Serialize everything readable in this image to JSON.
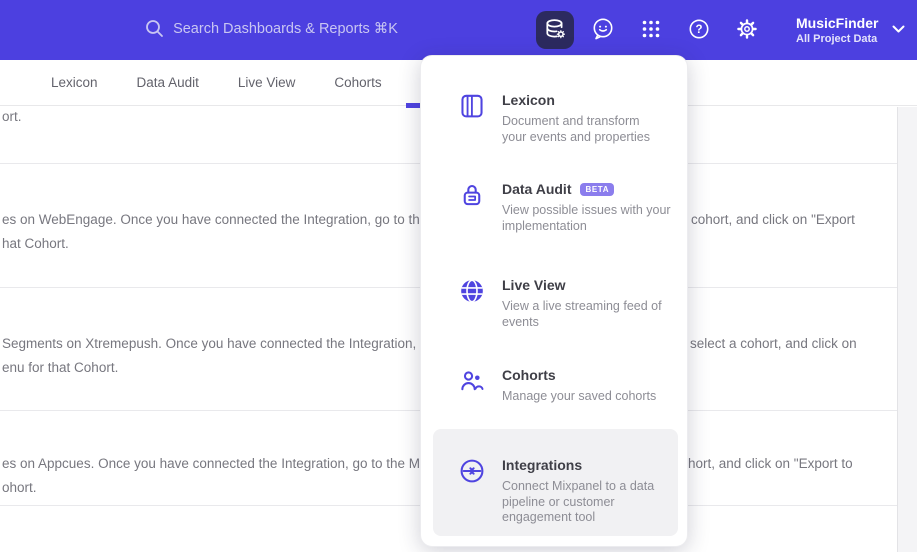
{
  "header": {
    "search_label": "Search Dashboards & Reports ⌘K",
    "project_name": "MusicFinder",
    "project_scope": "All Project Data"
  },
  "nav": {
    "tabs": [
      {
        "label": "Lexicon"
      },
      {
        "label": "Data Audit"
      },
      {
        "label": "Live View"
      },
      {
        "label": "Cohorts"
      }
    ]
  },
  "menu": {
    "items": [
      {
        "title": "Lexicon",
        "badge": "",
        "desc_lines": [
          "Document and transform",
          "your events and properties"
        ]
      },
      {
        "title": "Data Audit",
        "badge": "BETA",
        "desc_lines": [
          "View possible issues with your",
          "implementation"
        ]
      },
      {
        "title": "Live View",
        "badge": "",
        "desc_lines": [
          "View a live streaming feed of",
          "events"
        ]
      },
      {
        "title": "Cohorts",
        "badge": "",
        "desc_lines": [
          "Manage your saved cohorts"
        ]
      },
      {
        "title": "Integrations",
        "badge": "",
        "desc_lines": [
          "Connect Mixpanel to a data",
          "pipeline or customer",
          "engagement tool"
        ]
      }
    ]
  },
  "content": {
    "rows": [
      {
        "line1_left": "ort.",
        "line1_right": "",
        "line2": ""
      },
      {
        "line1_left": "es on WebEngage. Once you have connected the Integration, go to the",
        "line1_right": "cohort, and click on \"Export",
        "line2": "hat Cohort."
      },
      {
        "line1_left": "Segments on Xtremepush. Once you have connected the Integration,",
        "line1_right": "select a cohort, and click on",
        "line2": "enu for that Cohort."
      },
      {
        "line1_left": "es on Appcues. Once you have connected the Integration, go to the M",
        "line1_right": "hort, and click on \"Export to",
        "line2": "ohort."
      }
    ]
  },
  "icons": {
    "search": "magnifying-glass",
    "data_management": "database-with-gear",
    "feedback": "smiley-chat-bubble",
    "apps": "grid-9-dots",
    "help": "question-mark-circle",
    "settings": "gear",
    "project_expand": "chevron-down",
    "menu_lexicon": "book-journal",
    "menu_data_audit": "audit-lock-seal",
    "menu_live_view": "globe-filled",
    "menu_cohorts": "two-people",
    "menu_integrations": "sync-arrows-circle"
  },
  "colors": {
    "header_bg": "#4c40e0",
    "search_pill_bg": "#453dc6",
    "active_icon_bg": "#2c2a5f",
    "accent": "#4f44e0",
    "badge_bg": "#8b7ded",
    "menu_highlight_bg": "#f1f1f3"
  }
}
